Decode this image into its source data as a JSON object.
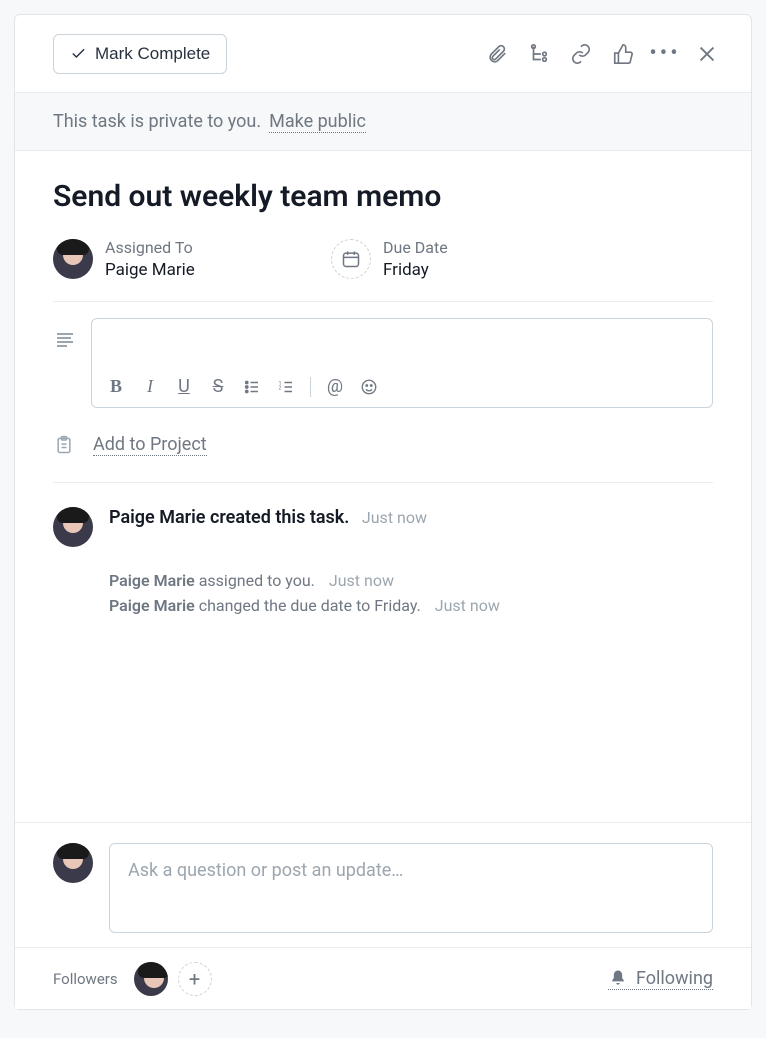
{
  "header": {
    "mark_complete": "Mark Complete"
  },
  "privacy": {
    "text": "This task is private to you.",
    "make_public": "Make public"
  },
  "task": {
    "title": "Send out weekly team memo"
  },
  "assignee": {
    "label": "Assigned To",
    "name": "Paige Marie"
  },
  "due": {
    "label": "Due Date",
    "value": "Friday"
  },
  "toolbar": {
    "bold": "B",
    "italic": "I",
    "underline": "U",
    "strike": "S",
    "at": "@"
  },
  "project": {
    "add": "Add to Project"
  },
  "activity": {
    "created": {
      "actor": "Paige Marie",
      "verb": "created this task.",
      "time": "Just now"
    },
    "sub1": {
      "actor": "Paige Marie",
      "text": "assigned to you.",
      "time": "Just now"
    },
    "sub2": {
      "actor": "Paige Marie",
      "text": "changed the due date to Friday.",
      "time": "Just now"
    }
  },
  "comment": {
    "placeholder": "Ask a question or post an update…"
  },
  "followers": {
    "label": "Followers",
    "following": "Following"
  }
}
